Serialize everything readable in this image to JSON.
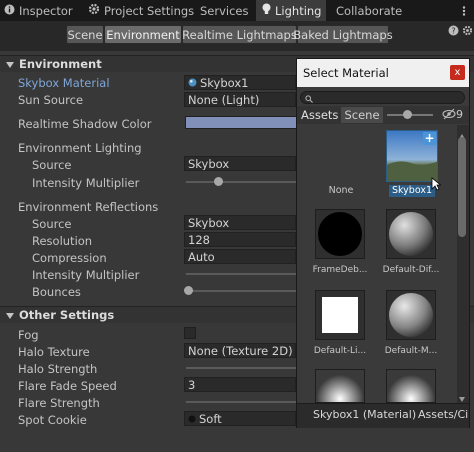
{
  "top_tabs": [
    {
      "label": "Inspector",
      "icon": "info-icon"
    },
    {
      "label": "Project Settings",
      "icon": "gear-icon"
    },
    {
      "label": "Services",
      "icon": ""
    },
    {
      "label": "Lighting",
      "icon": "lightbulb-icon"
    },
    {
      "label": "Collaborate",
      "icon": ""
    }
  ],
  "sub_tabs": [
    "Scene",
    "Environment",
    "Realtime Lightmaps",
    "Baked Lightmaps"
  ],
  "environment": {
    "header": "Environment",
    "skybox_material_label": "Skybox Material",
    "skybox_material_value": "Skybox1",
    "sun_source_label": "Sun Source",
    "sun_source_value": "None (Light)",
    "shadow_color_label": "Realtime Shadow Color",
    "shadow_color": "#8090b8",
    "env_lighting_label": "Environment Lighting",
    "lighting_source_label": "Source",
    "lighting_source_value": "Skybox",
    "lighting_intensity_label": "Intensity Multiplier",
    "env_reflections_label": "Environment Reflections",
    "reflections_source_label": "Source",
    "reflections_source_value": "Skybox",
    "resolution_label": "Resolution",
    "resolution_value": "128",
    "compression_label": "Compression",
    "compression_value": "Auto",
    "reflections_intensity_label": "Intensity Multiplier",
    "bounces_label": "Bounces"
  },
  "other_settings": {
    "header": "Other Settings",
    "fog_label": "Fog",
    "halo_texture_label": "Halo Texture",
    "halo_texture_value": "None (Texture 2D)",
    "halo_strength_label": "Halo Strength",
    "flare_fade_label": "Flare Fade Speed",
    "flare_fade_value": "3",
    "flare_strength_label": "Flare Strength",
    "spot_cookie_label": "Spot Cookie",
    "spot_cookie_value": "Soft"
  },
  "popup": {
    "title": "Select Material",
    "close_label": "x",
    "tab_assets": "Assets",
    "tab_scene": "Scene",
    "hidden_count": "9",
    "items": [
      "None",
      "Skybox1",
      "FrameDeb...",
      "Default-Dif...",
      "Default-Li...",
      "Default-M..."
    ],
    "footer_left": "Skybox1 (Material)",
    "footer_right": "Assets/Ci"
  },
  "colors": {
    "link": "#7fa7d8",
    "selection": "#2c5d87",
    "close_button": "#c42b1c"
  }
}
